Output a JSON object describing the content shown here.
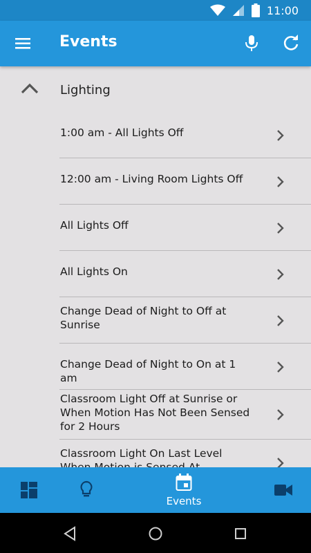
{
  "status_bar": {
    "time": "11:00"
  },
  "app_bar": {
    "title": "Events"
  },
  "section": {
    "label": "Lighting"
  },
  "events": [
    {
      "label": "1:00 am - All Lights Off"
    },
    {
      "label": "12:00 am - Living Room Lights Off"
    },
    {
      "label": "All Lights Off"
    },
    {
      "label": "All Lights On"
    },
    {
      "label": "Change Dead of Night to Off at Sunrise"
    },
    {
      "label": "Change Dead of Night to On at 1 am"
    },
    {
      "label": "Classroom Light Off at Sunrise or When Motion Has Not Been Sensed for 2 Hours"
    },
    {
      "label": "Classroom Light On Last Level When Motion is Sensed At Nighttime"
    }
  ],
  "bottom_nav": {
    "items": [
      {
        "icon": "dashboard-icon",
        "label": ""
      },
      {
        "icon": "lightbulb-icon",
        "label": ""
      },
      {
        "icon": "calendar-icon",
        "label": "Events"
      },
      {
        "icon": "video-camera-icon",
        "label": ""
      }
    ]
  },
  "colors": {
    "status_bar": "#1d86c6",
    "app_bar": "#2496db",
    "background": "#e3e1e3",
    "text": "#1c1c1c"
  }
}
